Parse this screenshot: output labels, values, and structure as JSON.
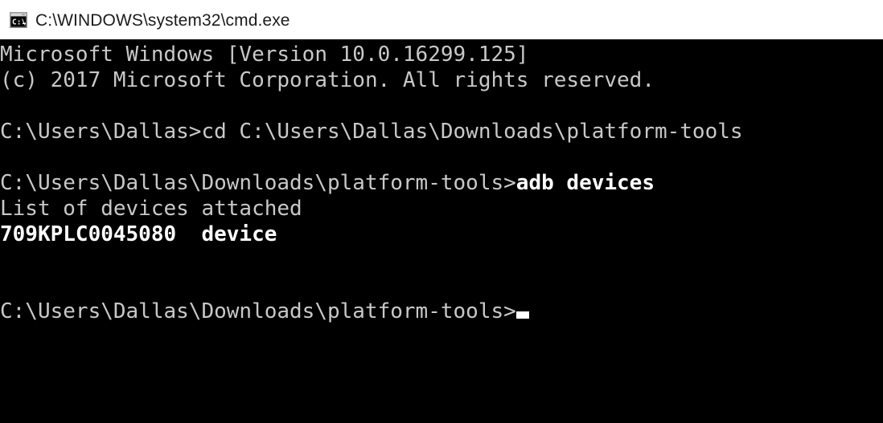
{
  "window": {
    "title": "C:\\WINDOWS\\system32\\cmd.exe",
    "icon": "cmd-console-icon",
    "titlebar_background": "#ffffff",
    "titlebar_text_color": "#1b1b1b"
  },
  "terminal": {
    "background": "#000000",
    "foreground": "#c8c8c8",
    "bright_foreground": "#ffffff",
    "cursor": "_",
    "lines": [
      {
        "id": "line-banner-version",
        "segments": [
          {
            "text": "Microsoft Windows [Version 10.0.16299.125]",
            "weight": "normal"
          }
        ]
      },
      {
        "id": "line-banner-copyright",
        "segments": [
          {
            "text": "(c) 2017 Microsoft Corporation. All rights reserved.",
            "weight": "normal"
          }
        ]
      },
      {
        "id": "line-blank-1",
        "segments": [
          {
            "text": " ",
            "weight": "normal"
          }
        ]
      },
      {
        "id": "line-cd-command",
        "segments": [
          {
            "text": "C:\\Users\\Dallas>",
            "weight": "normal"
          },
          {
            "text": "cd C:\\Users\\Dallas\\Downloads\\platform-tools",
            "weight": "normal"
          }
        ]
      },
      {
        "id": "line-blank-2",
        "segments": [
          {
            "text": " ",
            "weight": "normal"
          }
        ]
      },
      {
        "id": "line-adb-command",
        "segments": [
          {
            "text": "C:\\Users\\Dallas\\Downloads\\platform-tools>",
            "weight": "normal"
          },
          {
            "text": "adb devices",
            "weight": "bold"
          }
        ]
      },
      {
        "id": "line-devices-header",
        "segments": [
          {
            "text": "List of devices attached",
            "weight": "normal"
          }
        ]
      },
      {
        "id": "line-device-entry",
        "segments": [
          {
            "text": "709KPLC0045080  device",
            "weight": "bold"
          }
        ]
      },
      {
        "id": "line-blank-3",
        "segments": [
          {
            "text": " ",
            "weight": "normal"
          }
        ]
      },
      {
        "id": "line-blank-4",
        "segments": [
          {
            "text": " ",
            "weight": "normal"
          }
        ]
      },
      {
        "id": "line-final-prompt",
        "segments": [
          {
            "text": "C:\\Users\\Dallas\\Downloads\\platform-tools>",
            "weight": "normal"
          }
        ],
        "cursor": true
      }
    ]
  }
}
